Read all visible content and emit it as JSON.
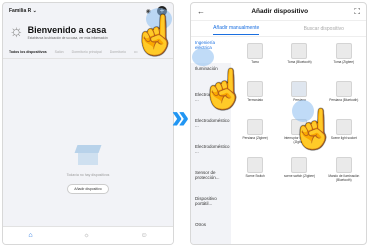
{
  "left": {
    "family": "Familia R",
    "welcome_title": "Bienvenido a casa",
    "welcome_sub": "Establezca la ubicación de su casa, ver más información",
    "tabs": [
      "Todos los dispositivos",
      "Salón",
      "Dormitorio principal",
      "Dormitorio"
    ],
    "empty_text": "Todavía no hay dispositivos",
    "add_button": "Añadir dispositivo"
  },
  "right": {
    "title": "Añadir dispositivo",
    "tab_manual": "Añadir manualmente",
    "tab_search": "Buscar dispositivo",
    "categories": [
      "Ingeniería eléctrica",
      "Iluminación",
      "Electrodoméstico ...",
      "Electrodoméstico ...",
      "Electrodoméstico ...",
      "Sensor de protección...",
      "Dispositivo portátil...",
      "Otros"
    ],
    "devices": [
      "Tomo",
      "Toma (Bluetooth)",
      "Toma (Zigbee)",
      "Termostato",
      "Persiana",
      "Persiana (Bluetooth)",
      "Persiana (Zigbee)",
      "Interruptor de cortinas (Zigbee)",
      "Scene light socket",
      "Scene Switch",
      "scene switch (Zigbee)",
      "Mando de iluminación (Bluetooth)"
    ]
  },
  "colors": {
    "accent": "#1a6fe0",
    "chevron": "#2196f3"
  }
}
